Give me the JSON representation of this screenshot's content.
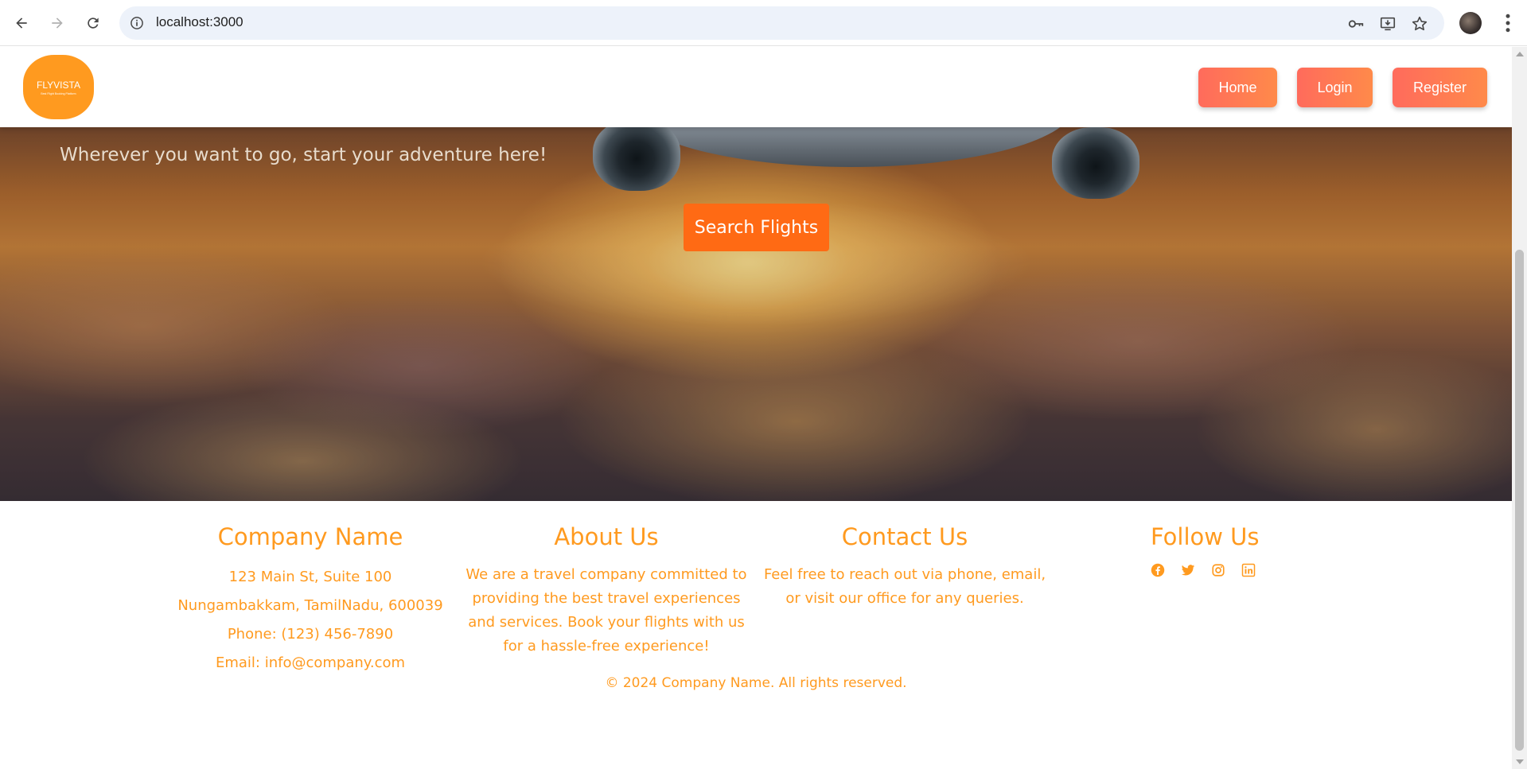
{
  "browser": {
    "url": "localhost:3000",
    "icons": [
      "back-arrow-icon",
      "forward-arrow-icon",
      "reload-icon",
      "site-info-icon",
      "password-key-icon",
      "install-app-icon",
      "bookmark-star-icon",
      "profile-avatar",
      "more-menu-icon"
    ]
  },
  "header": {
    "logo": {
      "title": "FLYVISTA",
      "tagline": "Best Flight Booking Platform"
    },
    "nav": [
      {
        "label": "Home"
      },
      {
        "label": "Login"
      },
      {
        "label": "Register"
      }
    ],
    "gradient": [
      "#ff6b5c",
      "#ff8a4a"
    ]
  },
  "hero": {
    "tagline": "Wherever you want to go, start your adventure here!",
    "cta_label": "Search Flights",
    "cta_color": "#ff6a14"
  },
  "footer": {
    "accent_color": "#ff9a1f",
    "company": {
      "heading": "Company Name",
      "address_line1": "123 Main St, Suite 100",
      "address_line2": "Nungambakkam, TamilNadu, 600039",
      "phone": "Phone: (123) 456-7890",
      "email": "Email: info@company.com"
    },
    "about": {
      "heading": "About Us",
      "lines": [
        "We are a travel company committed to",
        "providing the best travel experiences",
        "and services. Book your flights with us",
        "for a hassle-free experience!"
      ]
    },
    "contact": {
      "heading": "Contact Us",
      "lines": [
        "Feel free to reach out via phone, email,",
        "or visit our office for any queries."
      ]
    },
    "follow": {
      "heading": "Follow Us",
      "icons": [
        "facebook-icon",
        "twitter-icon",
        "instagram-icon",
        "linkedin-icon"
      ]
    },
    "copyright": "© 2024 Company Name. All rights reserved."
  }
}
